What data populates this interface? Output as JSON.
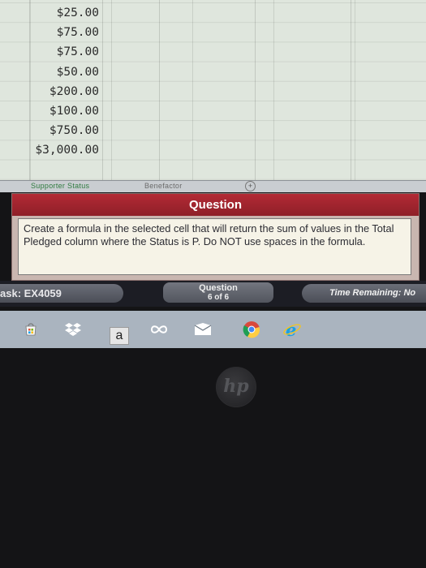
{
  "spreadsheet": {
    "amounts": [
      "$25.00",
      "$75.00",
      "$75.00",
      "$50.00",
      "$200.00",
      "$100.00",
      "$750.00",
      "$3,000.00"
    ],
    "sheet_tabs": [
      "Supporter Status",
      "Benefactor"
    ],
    "add_tab_glyph": "+"
  },
  "question": {
    "header": "Question",
    "text": "Create a formula in the selected cell that will return the sum of values in the Total Pledged column where the Status is P. Do NOT use spaces in the formula."
  },
  "statusbar": {
    "task_label": "ask: EX4059",
    "question_label": "Question",
    "question_progress": "6 of 6",
    "time_remaining_label": "Time Remaining:  No"
  },
  "taskbar": {
    "icons": [
      "windows-store-icon",
      "dropbox-icon",
      "amazon-icon",
      "infinity-icon",
      "mail-icon",
      "chrome-icon",
      "internet-explorer-icon"
    ],
    "amazon_glyph": "a"
  },
  "device": {
    "logo_text": "hp"
  },
  "colors": {
    "question_header": "#a3252f",
    "sheet_background": "#dfe6dd",
    "taskbar": "#aab4bf"
  }
}
